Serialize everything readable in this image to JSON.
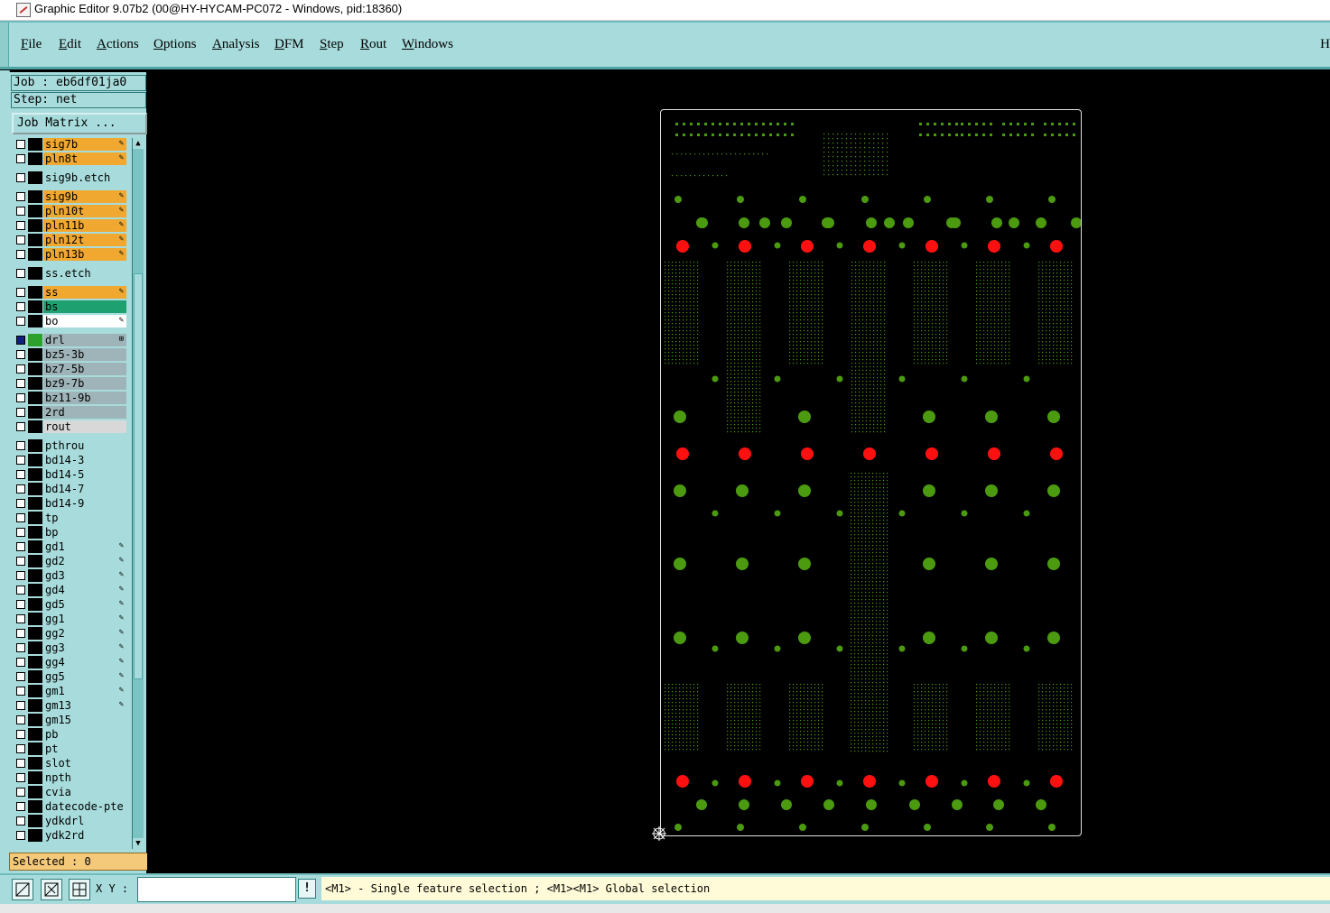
{
  "window": {
    "title": "Graphic Editor 9.07b2 (00@HY-HYCAM-PC072 - Windows, pid:18360)"
  },
  "menu": [
    {
      "label": "File",
      "mnemonic": "F",
      "rest": "ile"
    },
    {
      "label": "Edit",
      "mnemonic": "E",
      "rest": "dit"
    },
    {
      "label": "Actions",
      "mnemonic": "A",
      "rest": "ctions"
    },
    {
      "label": "Options",
      "mnemonic": "O",
      "rest": "ptions"
    },
    {
      "label": "Analysis",
      "mnemonic": "A",
      "rest": "nalysis"
    },
    {
      "label": "DFM",
      "mnemonic": "D",
      "rest": "FM"
    },
    {
      "label": "Step",
      "mnemonic": "S",
      "rest": "tep"
    },
    {
      "label": "Rout",
      "mnemonic": "R",
      "rest": "out"
    },
    {
      "label": "Windows",
      "mnemonic": "W",
      "rest": "indows"
    }
  ],
  "menu_right_char": "H",
  "job": {
    "job_label": "Job : eb6df01ja0",
    "step_label": "Step: net",
    "matrix_button": "Job Matrix ..."
  },
  "colors": {
    "orange_layer": "#f0a830",
    "teal_layer": "#a8dcdc",
    "green_layer": "#1fa070",
    "gray_layer": "#9fb4b8",
    "light_gray_layer": "#d8d8d8",
    "white_layer": "#ffffff",
    "pad_green": "#4c9a10",
    "pad_red": "#ff1010",
    "board_outline": "#e0e0e0"
  },
  "layers": [
    {
      "name": "sig7b",
      "color": "orange",
      "flag": "edit"
    },
    {
      "name": "pln8t",
      "color": "orange",
      "flag": "edit"
    },
    {
      "name": "sig9b.etch",
      "color": "teal",
      "flag": ""
    },
    {
      "name": "sig9b",
      "color": "orange",
      "flag": "edit"
    },
    {
      "name": "pln10t",
      "color": "orange",
      "flag": "edit"
    },
    {
      "name": "pln11b",
      "color": "orange",
      "flag": "edit"
    },
    {
      "name": "pln12t",
      "color": "orange",
      "flag": "edit"
    },
    {
      "name": "pln13b",
      "color": "orange",
      "flag": "edit"
    },
    {
      "name": "ss.etch",
      "color": "teal",
      "flag": ""
    },
    {
      "name": "ss",
      "color": "orange",
      "flag": "edit"
    },
    {
      "name": "bs",
      "color": "green",
      "flag": ""
    },
    {
      "name": "bo",
      "color": "white",
      "flag": "edit"
    },
    {
      "name": "drl",
      "color": "gray",
      "flag": "work",
      "selected": true
    },
    {
      "name": "bz5-3b",
      "color": "gray",
      "flag": ""
    },
    {
      "name": "bz7-5b",
      "color": "gray",
      "flag": ""
    },
    {
      "name": "bz9-7b",
      "color": "gray",
      "flag": ""
    },
    {
      "name": "bz11-9b",
      "color": "gray",
      "flag": ""
    },
    {
      "name": "2rd",
      "color": "gray",
      "flag": ""
    },
    {
      "name": "rout",
      "color": "light",
      "flag": ""
    },
    {
      "name": "pthrou",
      "color": "teal",
      "flag": ""
    },
    {
      "name": "bd14-3",
      "color": "teal",
      "flag": ""
    },
    {
      "name": "bd14-5",
      "color": "teal",
      "flag": ""
    },
    {
      "name": "bd14-7",
      "color": "teal",
      "flag": ""
    },
    {
      "name": "bd14-9",
      "color": "teal",
      "flag": ""
    },
    {
      "name": "tp",
      "color": "teal",
      "flag": ""
    },
    {
      "name": "bp",
      "color": "teal",
      "flag": ""
    },
    {
      "name": "gd1",
      "color": "teal",
      "flag": "edit"
    },
    {
      "name": "gd2",
      "color": "teal",
      "flag": "edit"
    },
    {
      "name": "gd3",
      "color": "teal",
      "flag": "edit"
    },
    {
      "name": "gd4",
      "color": "teal",
      "flag": "edit"
    },
    {
      "name": "gd5",
      "color": "teal",
      "flag": "edit"
    },
    {
      "name": "gg1",
      "color": "teal",
      "flag": "edit"
    },
    {
      "name": "gg2",
      "color": "teal",
      "flag": "edit"
    },
    {
      "name": "gg3",
      "color": "teal",
      "flag": "edit"
    },
    {
      "name": "gg4",
      "color": "teal",
      "flag": "edit"
    },
    {
      "name": "gg5",
      "color": "teal",
      "flag": "edit"
    },
    {
      "name": "gm1",
      "color": "teal",
      "flag": "edit"
    },
    {
      "name": "gm13",
      "color": "teal",
      "flag": "edit"
    },
    {
      "name": "gm15",
      "color": "teal",
      "flag": ""
    },
    {
      "name": "pb",
      "color": "teal",
      "flag": ""
    },
    {
      "name": "pt",
      "color": "teal",
      "flag": ""
    },
    {
      "name": "slot",
      "color": "teal",
      "flag": ""
    },
    {
      "name": "npth",
      "color": "teal",
      "flag": ""
    },
    {
      "name": "cvia",
      "color": "teal",
      "flag": ""
    },
    {
      "name": "datecode-pte",
      "color": "teal",
      "flag": ""
    },
    {
      "name": "ydkdrl",
      "color": "teal",
      "flag": ""
    },
    {
      "name": "ydk2rd",
      "color": "teal",
      "flag": ""
    }
  ],
  "selected_label": "Selected : 0",
  "bottom": {
    "xy_label": "X Y :",
    "xy_value": "",
    "status_message": "<M1> - Single feature selection ; <M1><M1> Global selection"
  },
  "icons": {
    "tool_1": "zoom-box-icon",
    "tool_2": "snap-icon",
    "tool_3": "grid-icon",
    "warn": "exclamation-icon",
    "origin": "datum-origin-icon"
  }
}
